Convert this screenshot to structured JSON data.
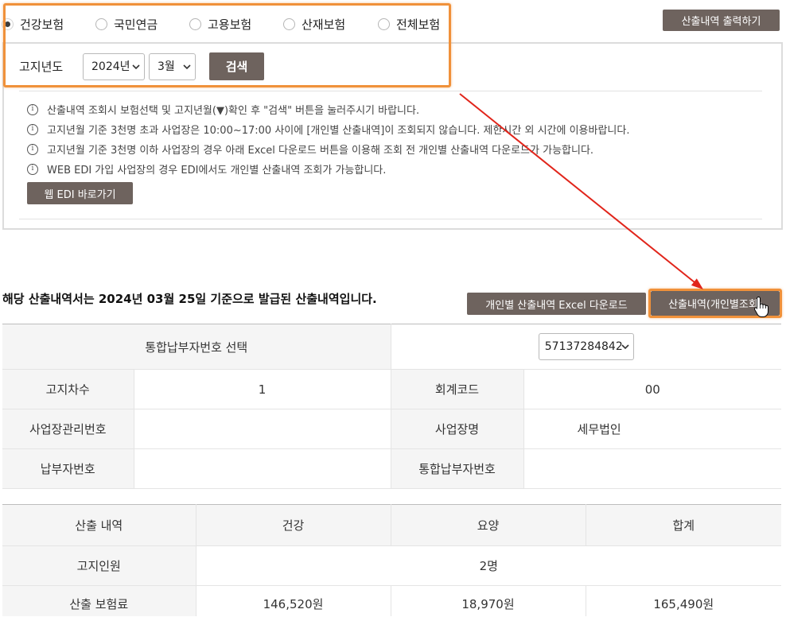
{
  "colors": {
    "button_bg": "#6e635e",
    "highlight_border": "#f0913a",
    "annotation_arrow": "#e1251b",
    "label_cell_bg": "#f5f5f5"
  },
  "icons": {
    "notice": "info-icon",
    "dropdown": "chevron-down-icon",
    "pointer": "hand-cursor-icon"
  },
  "insurance_types": [
    {
      "label": "건강보험",
      "selected": true
    },
    {
      "label": "국민연금",
      "selected": false
    },
    {
      "label": "고용보험",
      "selected": false
    },
    {
      "label": "산재보험",
      "selected": false
    },
    {
      "label": "전체보험",
      "selected": false
    }
  ],
  "toolbar": {
    "print_label": "산출내역 출력하기"
  },
  "search": {
    "year_label": "고지년도",
    "year_value": "2024년",
    "month_value": "3월",
    "search_label": "검색"
  },
  "notices": [
    "산출내역 조회시 보험선택 및 고지년월(▼)확인 후 \"검색\" 버튼을 눌러주시기 바랍니다.",
    "고지년월 기준 3천명 초과 사업장은 10:00~17:00 사이에 [개인별 산출내역]이 조회되지 않습니다. 제한시간 외 시간에 이용바랍니다.",
    "고지년월 기준 3천명 이하 사업장의 경우 아래 Excel 다운로드 버튼을 이용해 조회 전 개인별 산출내역 다운로드가 가능합니다.",
    "WEB EDI 가입 사업장의 경우 EDI에서도 개인별 산출내역 조회가 가능합니다."
  ],
  "edi_link_label": "웹 EDI 바로가기",
  "result": {
    "statement": "해당 산출내역서는 2024년 03월 25일 기준으로 발급된 산출내역입니다.",
    "excel_label": "개인별 산출내역 Excel 다운로드",
    "individual_label": "산출내역(개인별조회)"
  },
  "info_table": {
    "payer_select_label": "통합납부자번호 선택",
    "payer_select_value": "57137284842",
    "rows": [
      [
        {
          "label": "고지차수",
          "value": "1"
        },
        {
          "label": "회계코드",
          "value": "00"
        }
      ],
      [
        {
          "label": "사업장관리번호",
          "value": ""
        },
        {
          "label": "사업장명",
          "value": "세무법인"
        }
      ],
      [
        {
          "label": "납부자번호",
          "value": ""
        },
        {
          "label": "통합납부자번호",
          "value": ""
        }
      ]
    ]
  },
  "calc_table": {
    "headers": [
      "산출 내역",
      "건강",
      "요양",
      "합계"
    ],
    "headcount": {
      "label": "고지인원",
      "value": "2명"
    },
    "premium": {
      "label": "산출 보험료",
      "health": "146,520원",
      "long_term_care": "18,970원",
      "total": "165,490원"
    }
  }
}
